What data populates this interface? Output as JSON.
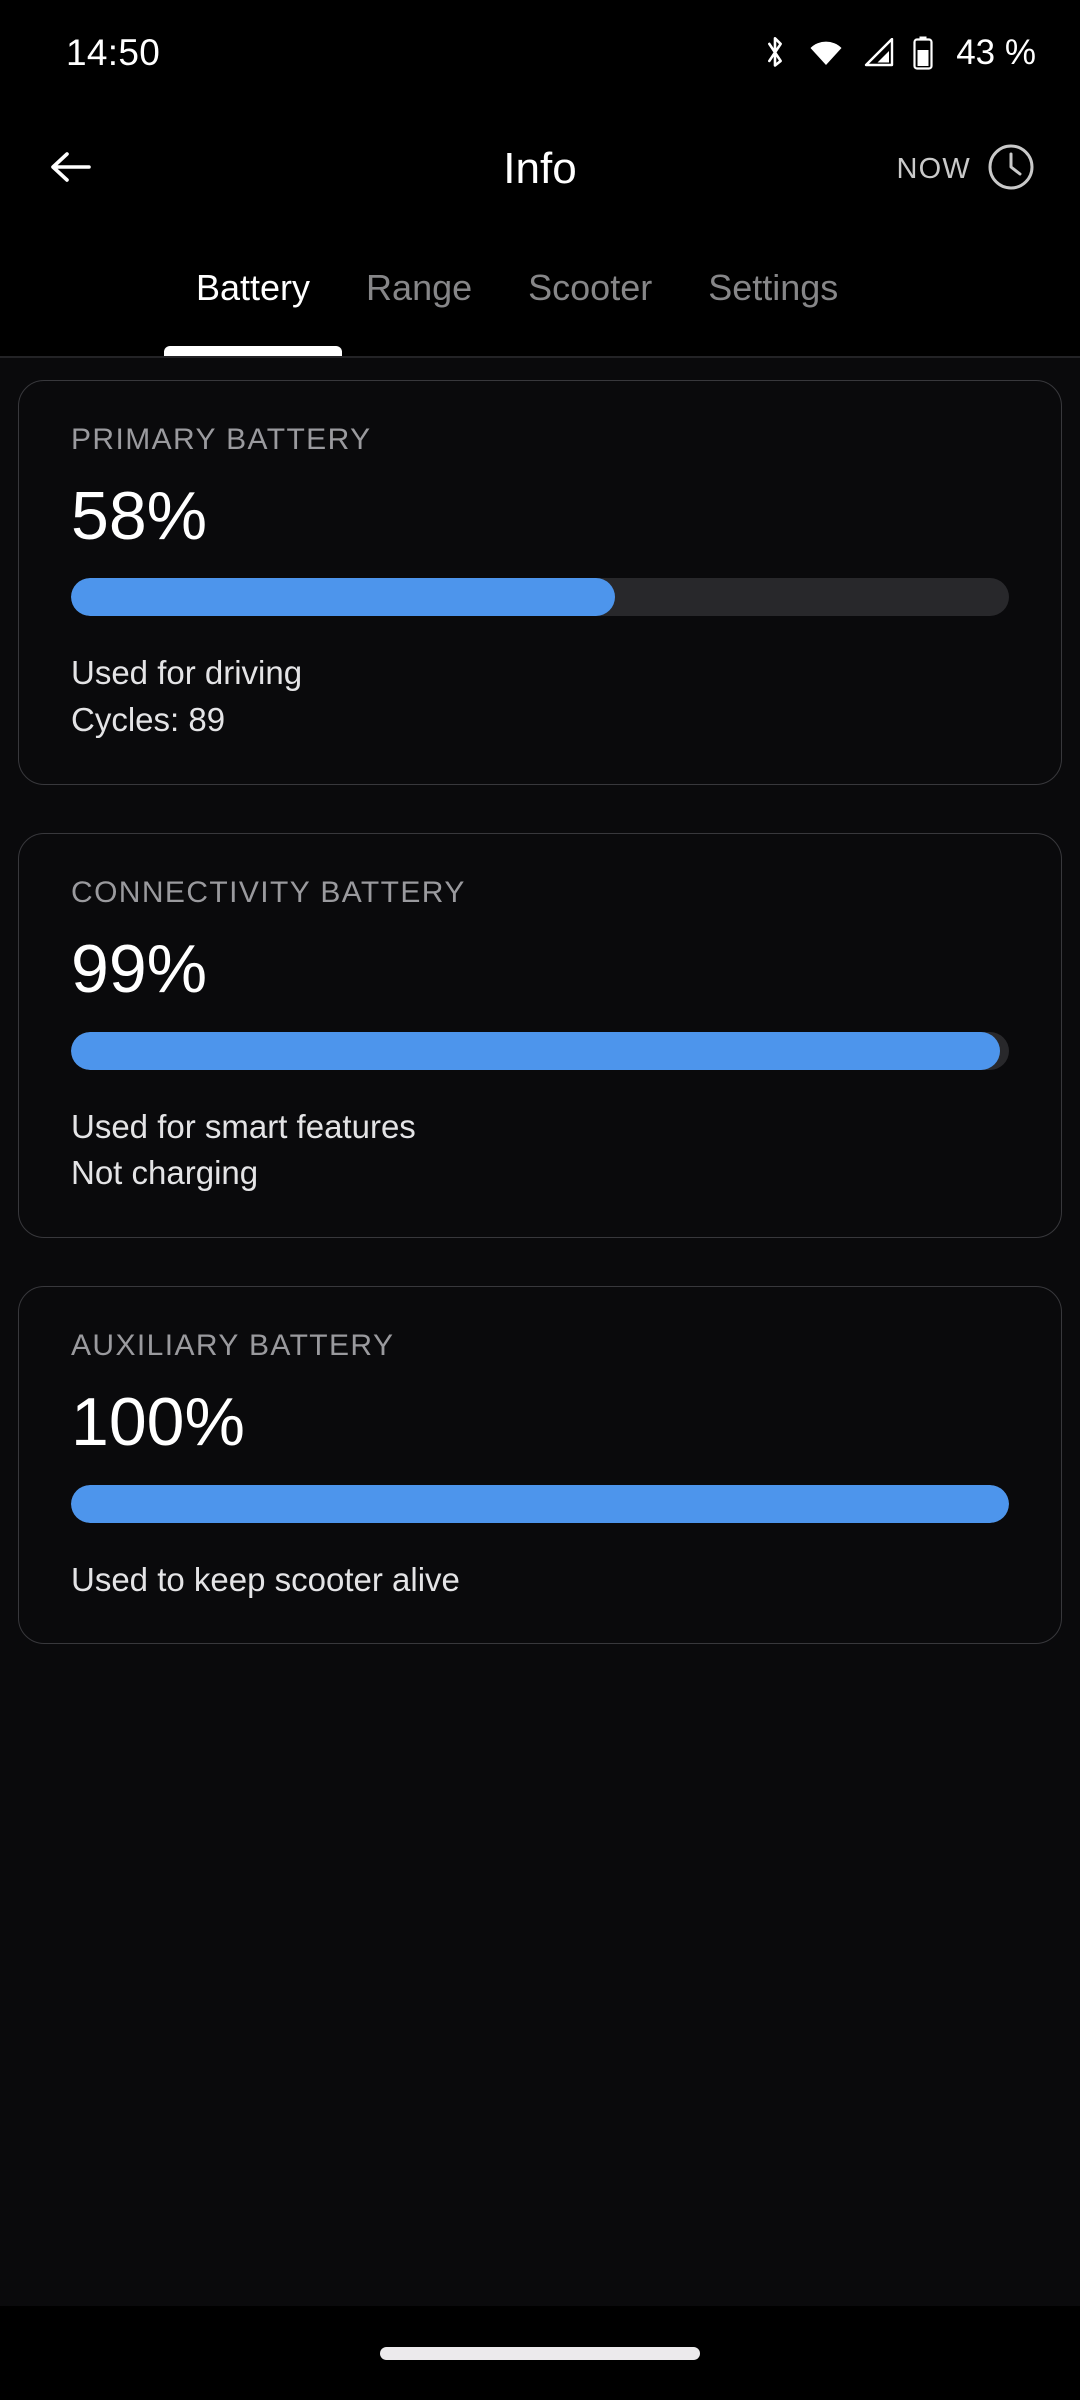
{
  "status_bar": {
    "time": "14:50",
    "battery_percent": "43 %",
    "icons": [
      "bluetooth-icon",
      "wifi-icon",
      "cellular-signal-icon",
      "battery-icon"
    ]
  },
  "app_bar": {
    "back": "back-arrow-icon",
    "title": "Info",
    "now_label": "NOW",
    "clock_icon": "clock-icon"
  },
  "tabs": [
    {
      "label": "Battery",
      "active": true
    },
    {
      "label": "Range",
      "active": false
    },
    {
      "label": "Scooter",
      "active": false
    },
    {
      "label": "Settings",
      "active": false
    }
  ],
  "cards": [
    {
      "title": "PRIMARY BATTERY",
      "percent_label": "58%",
      "percent_value": 58,
      "note_1": "Used for driving",
      "note_2": "Cycles: 89"
    },
    {
      "title": "CONNECTIVITY BATTERY",
      "percent_label": "99%",
      "percent_value": 99,
      "note_1": "Used for smart features",
      "note_2": "Not charging"
    },
    {
      "title": "AUXILIARY BATTERY",
      "percent_label": "100%",
      "percent_value": 100,
      "note_1": "Used to keep scooter alive",
      "note_2": ""
    }
  ],
  "colors": {
    "accent_blue": "#4d95ec",
    "track_gray": "#28282b",
    "card_border": "#38383c",
    "background": "#0a0a0c",
    "bar_black": "#000000",
    "muted_text": "#9a9a9e",
    "tab_inactive": "#868688"
  },
  "navigation": {
    "gesture_pill": "home-gesture-pill"
  }
}
